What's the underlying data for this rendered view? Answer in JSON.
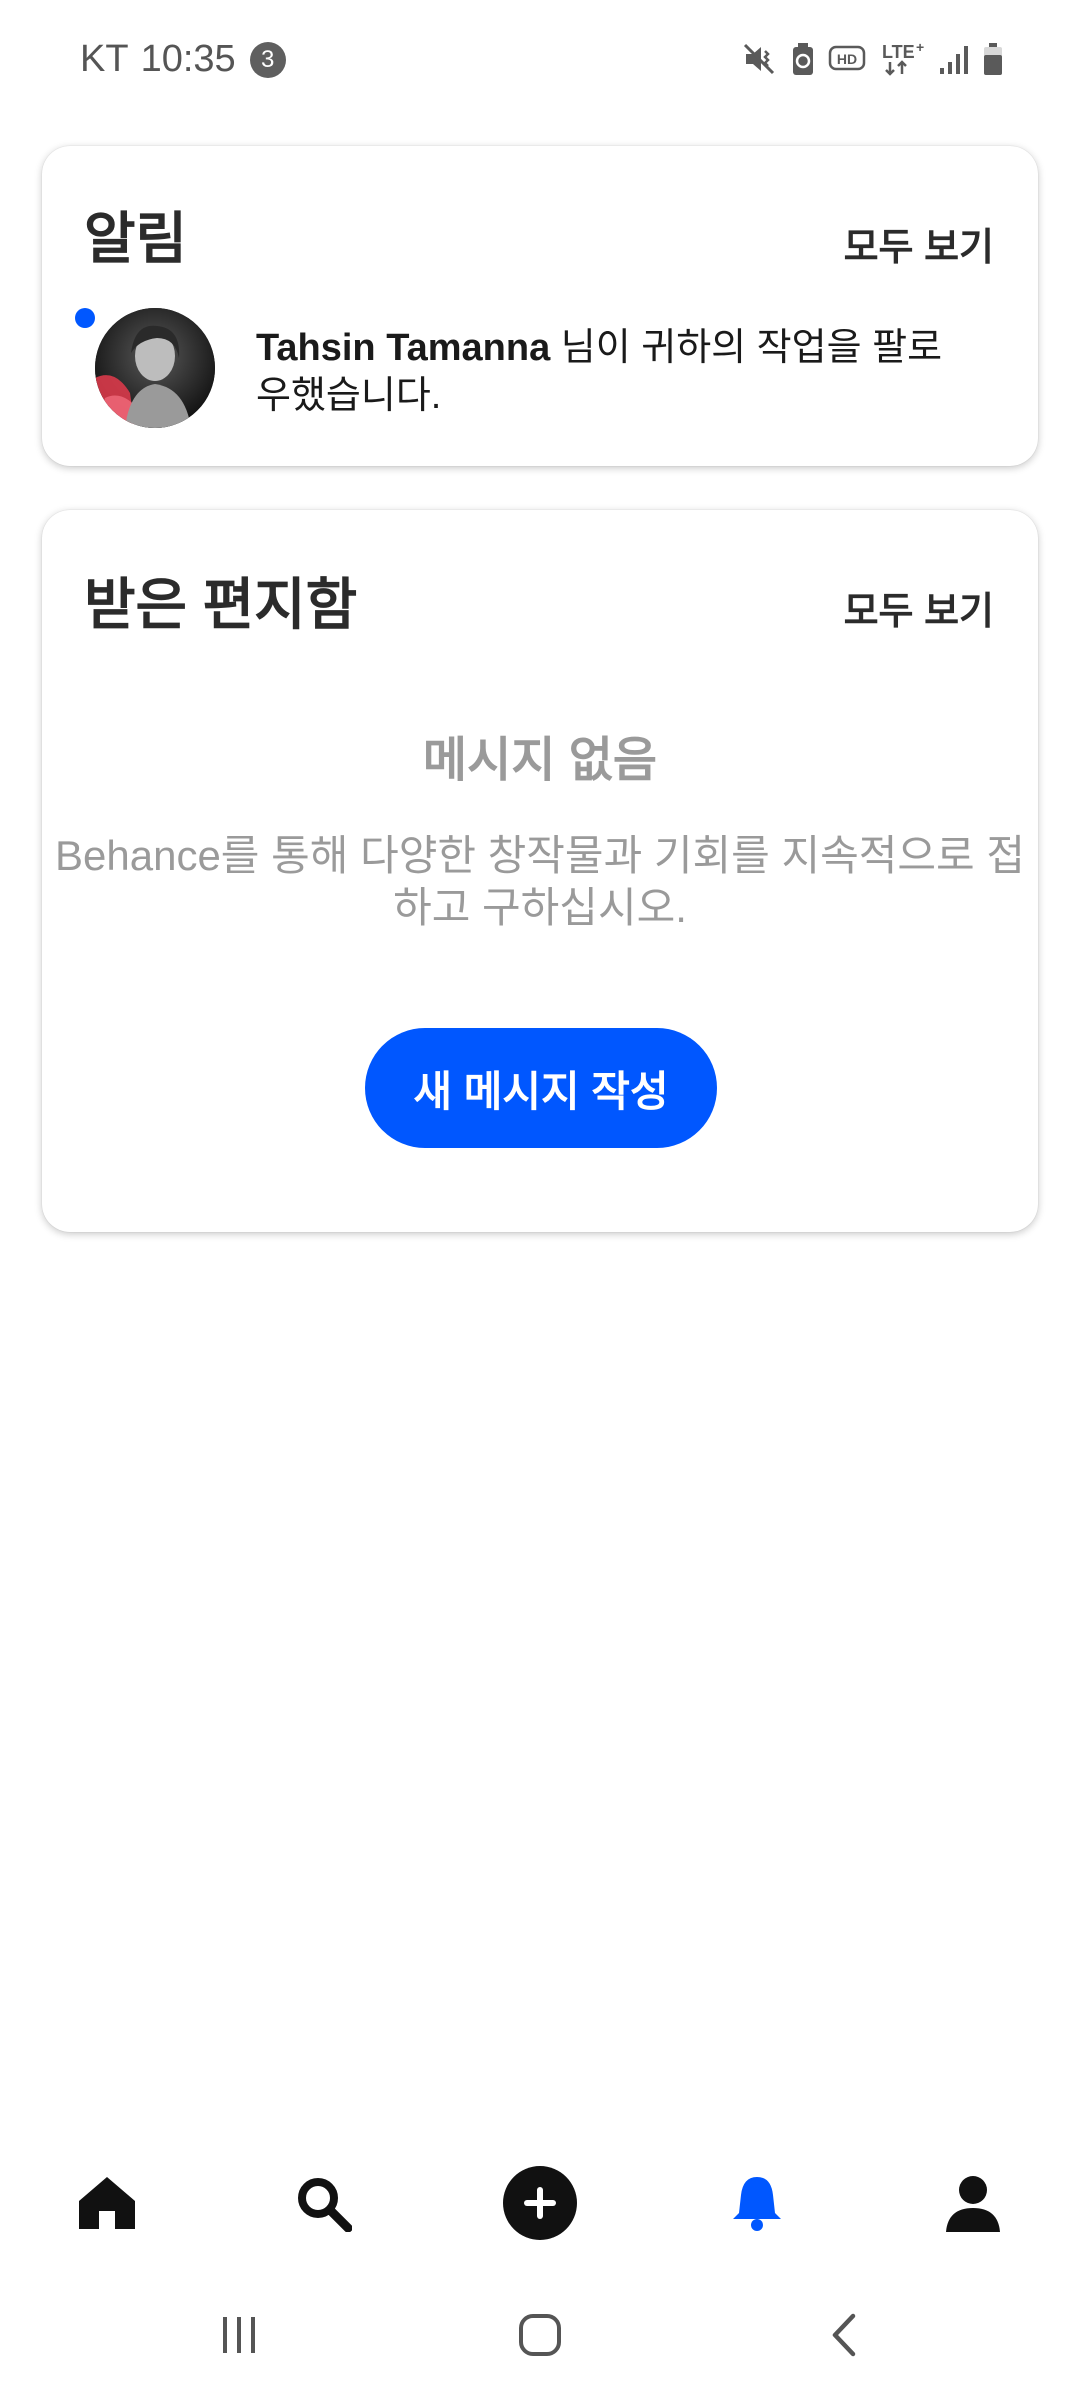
{
  "status_bar": {
    "carrier": "KT",
    "time": "10:35",
    "notification_count": "3",
    "icons": [
      "mute-vibrate-icon",
      "battery-saver-icon",
      "hd-icon",
      "lte-plus-icon",
      "signal-icon",
      "battery-icon"
    ]
  },
  "notifications": {
    "title": "알림",
    "see_all": "모두 보기",
    "items": [
      {
        "name": "Tahsin Tamanna",
        "text": " 님이 귀하의 작업을 팔로우했습니다.",
        "unread": true
      }
    ]
  },
  "inbox": {
    "title": "받은 편지함",
    "see_all": "모두 보기",
    "empty_title": "메시지 없음",
    "empty_desc": "Behance를 통해 다양한 창작물과 기회를 지속적으로 접하고 구하십시오.",
    "compose_label": "새 메시지 작성"
  },
  "bottom_nav": {
    "items": [
      "home-icon",
      "search-icon",
      "create-plus-icon",
      "notifications-bell-icon",
      "profile-icon"
    ],
    "active": "notifications-bell-icon"
  },
  "system_nav": {
    "items": [
      "recent-apps-icon",
      "home-circle-icon",
      "back-icon"
    ]
  },
  "colors": {
    "accent": "#0057ff",
    "muted_text": "#9a9a9a",
    "title_text": "#2b2b2b"
  }
}
